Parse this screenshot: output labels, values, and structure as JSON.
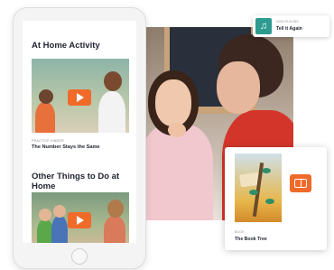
{
  "phone": {
    "section1_title": "At Home Activity",
    "video1": {
      "category": "PRACTICE KINDER",
      "title": "The Number Stays the Same"
    },
    "section2_title": "Other Things to Do at Home"
  },
  "now_playing": {
    "label": "NOW PLAYING",
    "title": "Tell it Again",
    "icon": "music-note-icon"
  },
  "book": {
    "label": "BOOK",
    "title": "The Book Tree",
    "icon": "open-book-icon"
  },
  "colors": {
    "accent_orange": "#f06a2a",
    "teal": "#2e9b91",
    "text_dark": "#1f2330"
  }
}
